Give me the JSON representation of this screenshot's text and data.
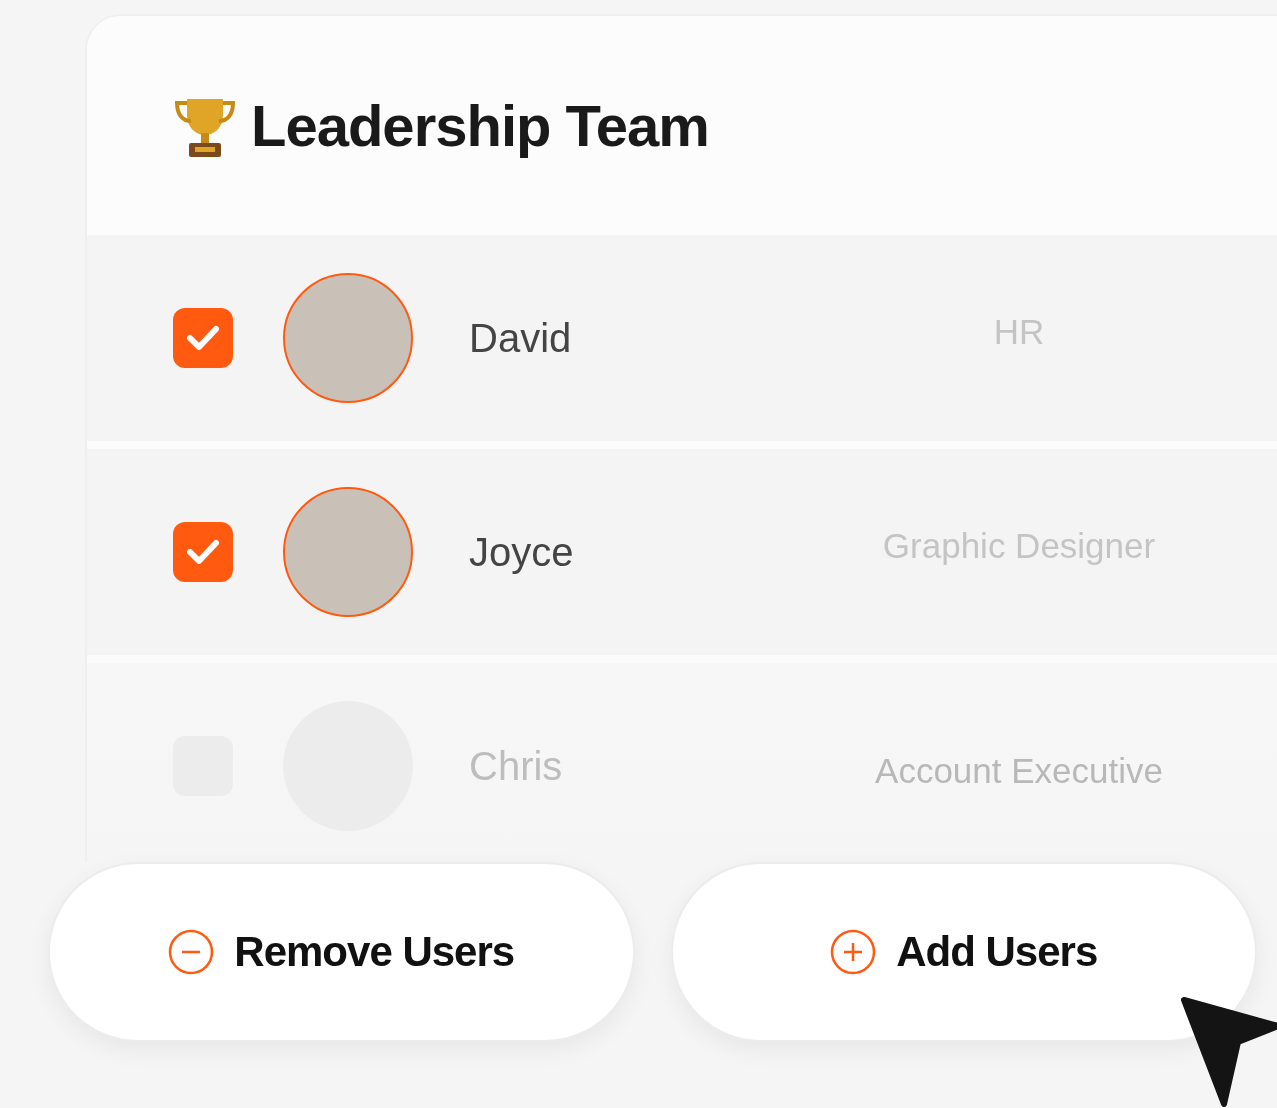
{
  "card": {
    "title": "Leadership Team",
    "members": [
      {
        "name": "David",
        "role": "HR",
        "checked": true,
        "disabled": false
      },
      {
        "name": "Joyce",
        "role": "Graphic Designer",
        "checked": true,
        "disabled": false
      },
      {
        "name": "Chris",
        "role": "Account Executive",
        "checked": false,
        "disabled": true
      }
    ]
  },
  "buttons": [
    {
      "kind": "remove",
      "label": "Remove Users"
    },
    {
      "kind": "add",
      "label": "Add Users"
    }
  ]
}
